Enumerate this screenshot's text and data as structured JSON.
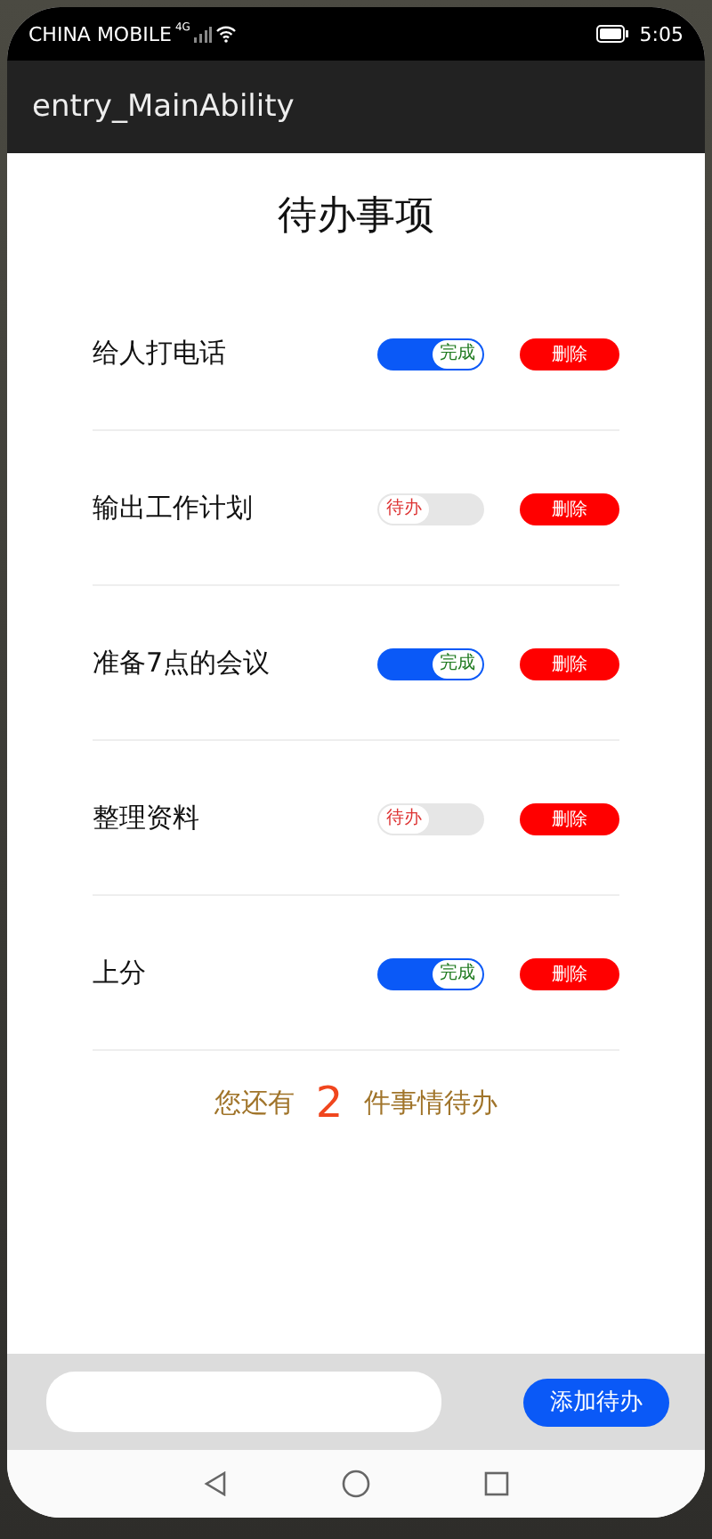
{
  "status_bar": {
    "carrier": "CHINA MOBILE",
    "network": "4G",
    "time": "5:05"
  },
  "app_bar": {
    "title": "entry_MainAbility"
  },
  "page_title": "待办事项",
  "todos": [
    {
      "text": "给人打电话",
      "done": true,
      "toggle_label": "完成",
      "delete_label": "删除"
    },
    {
      "text": "输出工作计划",
      "done": false,
      "toggle_label": "待办",
      "delete_label": "删除"
    },
    {
      "text": "准备7点的会议",
      "done": true,
      "toggle_label": "完成",
      "delete_label": "删除"
    },
    {
      "text": "整理资料",
      "done": false,
      "toggle_label": "待办",
      "delete_label": "删除"
    },
    {
      "text": "上分",
      "done": true,
      "toggle_label": "完成",
      "delete_label": "删除"
    }
  ],
  "summary": {
    "prefix": "您还有",
    "count": "2",
    "suffix": "件事情待办"
  },
  "add_bar": {
    "button": "添加待办"
  }
}
